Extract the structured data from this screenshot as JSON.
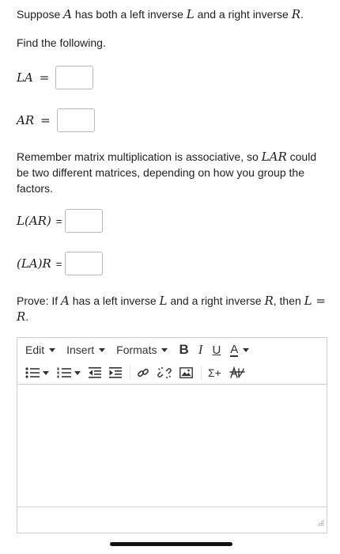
{
  "intro": {
    "t1": "Suppose ",
    "A": "A",
    "t2": " has both a left inverse ",
    "L": "L",
    "t3": " and a right inverse ",
    "R": "R",
    "t4": "."
  },
  "find_label": "Find the following.",
  "q1": {
    "lhs": "LA",
    "eq": "="
  },
  "q2": {
    "lhs": "AR",
    "eq": "="
  },
  "remember": {
    "t1": "Remember matrix multiplication is associative, so ",
    "m": "LAR",
    "t2": " could be two different matrices, depending on how you group the factors."
  },
  "q3": {
    "lhs": "L(AR)",
    "eq": "="
  },
  "q4": {
    "lhs": "(LA)R",
    "eq": "="
  },
  "prove": {
    "t1": "Prove: If ",
    "A": "A",
    "t2": " has a left inverse ",
    "L": "L",
    "t3": " and a right inverse ",
    "R": "R",
    "t4": ", then ",
    "L2": "L",
    "eq": " = ",
    "R2": "R",
    "t5": "."
  },
  "editor": {
    "menu": {
      "edit": "Edit",
      "insert": "Insert",
      "formats": "Formats"
    },
    "bold": "B",
    "italic": "I",
    "underline": "U",
    "textcolor": "A",
    "sigma": "Σ+",
    "colors": {
      "border": "#cfcfcf",
      "icon": "#333333"
    }
  }
}
